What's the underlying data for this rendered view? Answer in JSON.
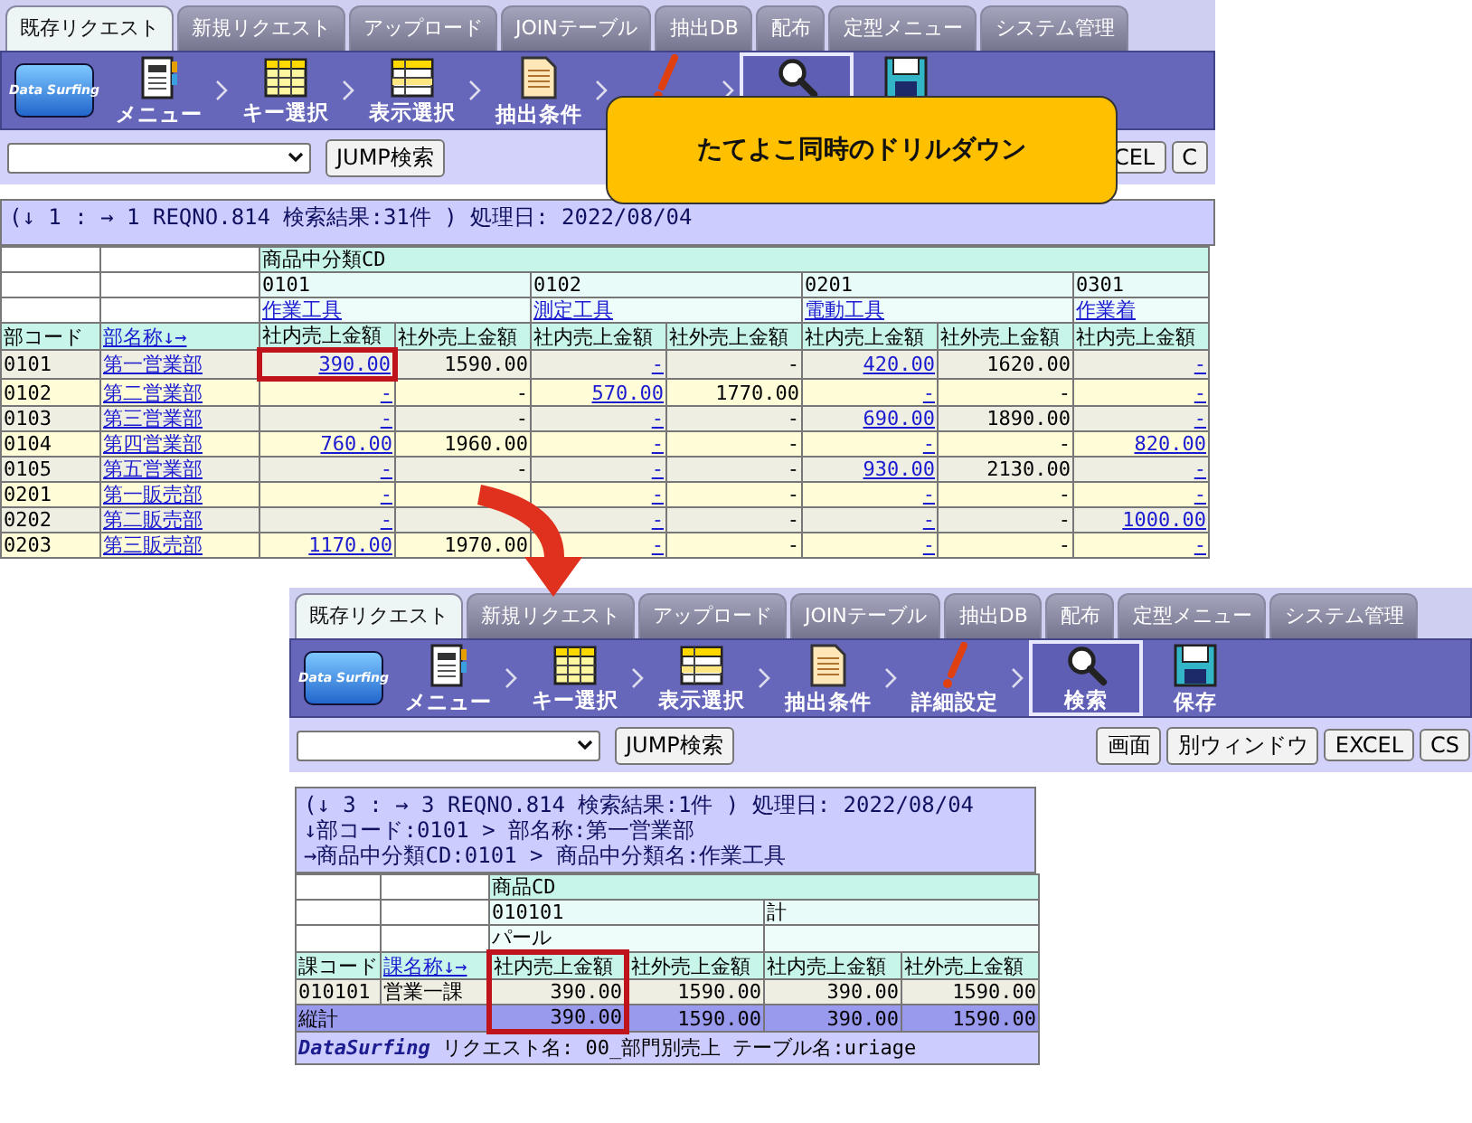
{
  "windows": [
    {
      "tabs": [
        {
          "label": "既存リクエスト",
          "selected": true
        },
        {
          "label": "新規リクエスト",
          "selected": false
        },
        {
          "label": "アップロード",
          "selected": false
        },
        {
          "label": "JOINテーブル",
          "selected": false
        },
        {
          "label": "抽出DB",
          "selected": false
        },
        {
          "label": "配布",
          "selected": false
        },
        {
          "label": "定型メニュー",
          "selected": false
        },
        {
          "label": "システム管理",
          "selected": false
        }
      ],
      "toolbar": {
        "logo_text": "Data Surfing",
        "items": [
          {
            "kind": "menu",
            "label": "メニュー",
            "selected": false
          },
          {
            "kind": "key",
            "label": "キー選択",
            "selected": false
          },
          {
            "kind": "display",
            "label": "表示選択",
            "selected": false
          },
          {
            "kind": "filter",
            "label": "抽出条件",
            "selected": false
          },
          {
            "kind": "detail",
            "selected": false
          },
          {
            "kind": "search",
            "selected": true
          },
          {
            "kind": "save",
            "selected": false
          }
        ]
      },
      "nav": {
        "jump_button": "JUMP検索",
        "buttons": [
          "CEL",
          "C"
        ]
      },
      "info": [
        "(↓ 1 : → 1 REQNO.814 検索結果:31件 ) 処理日: 2022/08/04"
      ],
      "table": {
        "dimension": "商品中分類CD",
        "groups": [
          {
            "code": "0101",
            "name": "作業工具",
            "link": true
          },
          {
            "code": "0102",
            "name": "測定工具",
            "link": true
          },
          {
            "code": "0201",
            "name": "電動工具",
            "link": true
          },
          {
            "code": "0301",
            "name": "作業着",
            "link": true
          }
        ],
        "columns": [
          {
            "header": "部コード",
            "header_link": false,
            "link": false,
            "highlighted": false
          },
          {
            "header": "部名称↓→",
            "header_link": true,
            "link": true,
            "highlighted": false
          },
          {
            "header": "社内売上金額",
            "header_link": false,
            "link": true,
            "highlighted": false
          },
          {
            "header": "社外売上金額",
            "header_link": false,
            "link": false,
            "highlighted": false
          },
          {
            "header": "社内売上金額",
            "header_link": false,
            "link": true,
            "highlighted": false
          },
          {
            "header": "社外売上金額",
            "header_link": false,
            "link": false,
            "highlighted": false
          },
          {
            "header": "社内売上金額",
            "header_link": false,
            "link": true,
            "highlighted": false
          },
          {
            "header": "社外売上金額",
            "header_link": false,
            "link": false,
            "highlighted": false
          },
          {
            "header": "社内売上金額",
            "header_link": false,
            "link": true,
            "highlighted": false
          }
        ],
        "rows": [
          {
            "cells": [
              "0101",
              "第一営業部",
              "390.00",
              "1590.00",
              "-",
              "-",
              "420.00",
              "1620.00",
              "-"
            ],
            "highlighted": true
          },
          {
            "cells": [
              "0102",
              "第二営業部",
              "-",
              "-",
              "570.00",
              "1770.00",
              "-",
              "-",
              "-"
            ],
            "highlighted": false
          },
          {
            "cells": [
              "0103",
              "第三営業部",
              "-",
              "-",
              "-",
              "-",
              "690.00",
              "1890.00",
              "-"
            ],
            "highlighted": false
          },
          {
            "cells": [
              "0104",
              "第四営業部",
              "760.00",
              "1960.00",
              "-",
              "-",
              "-",
              "-",
              "820.00"
            ],
            "highlighted": false
          },
          {
            "cells": [
              "0105",
              "第五営業部",
              "-",
              "-",
              "-",
              "-",
              "930.00",
              "2130.00",
              "-"
            ],
            "highlighted": false
          },
          {
            "cells": [
              "0201",
              "第一販売部",
              "-",
              null,
              "-",
              "-",
              "-",
              "-",
              "-"
            ],
            "highlighted": false
          },
          {
            "cells": [
              "0202",
              "第二販売部",
              "-",
              null,
              "-",
              "-",
              "-",
              "-",
              "1000.00"
            ],
            "highlighted": false
          },
          {
            "cells": [
              "0203",
              "第三販売部",
              "1170.00",
              "1970.00",
              "-",
              "-",
              "-",
              "-",
              "-"
            ],
            "highlighted": false
          }
        ]
      }
    },
    {
      "tabs": [
        {
          "label": "既存リクエスト",
          "selected": true
        },
        {
          "label": "新規リクエスト",
          "selected": false
        },
        {
          "label": "アップロード",
          "selected": false
        },
        {
          "label": "JOINテーブル",
          "selected": false
        },
        {
          "label": "抽出DB",
          "selected": false
        },
        {
          "label": "配布",
          "selected": false
        },
        {
          "label": "定型メニュー",
          "selected": false
        },
        {
          "label": "システム管理",
          "selected": false
        }
      ],
      "toolbar": {
        "logo_text": "Data Surfing",
        "items": [
          {
            "kind": "menu",
            "label": "メニュー",
            "selected": false
          },
          {
            "kind": "key",
            "label": "キー選択",
            "selected": false
          },
          {
            "kind": "display",
            "label": "表示選択",
            "selected": false
          },
          {
            "kind": "filter",
            "label": "抽出条件",
            "selected": false
          },
          {
            "kind": "detail",
            "label": "詳細設定",
            "selected": false
          },
          {
            "kind": "search",
            "label": "検索",
            "selected": true
          },
          {
            "kind": "save",
            "label": "保存",
            "selected": false
          }
        ]
      },
      "nav": {
        "jump_button": "JUMP検索",
        "buttons": [
          "画面",
          "別ウィンドウ",
          "EXCEL",
          "CS"
        ]
      },
      "info": [
        "(↓ 3 : → 3 REQNO.814 検索結果:1件 ) 処理日: 2022/08/04",
        "↓部コード:0101 > 部名称:第一営業部",
        "→商品中分類CD:0101 > 商品中分類名:作業工具"
      ],
      "table": {
        "dimension": "商品CD",
        "groups": [
          {
            "code": "010101",
            "name": "パール",
            "link": false
          },
          {
            "code": "計"
          }
        ],
        "columns": [
          {
            "header": "課コード",
            "header_link": false,
            "link": false,
            "highlighted": false
          },
          {
            "header": "課名称↓→",
            "header_link": true,
            "link": false,
            "highlighted": false
          },
          {
            "header": "社内売上金額",
            "header_link": false,
            "link": false,
            "highlighted": true
          },
          {
            "header": "社外売上金額",
            "header_link": false,
            "link": false,
            "highlighted": false
          },
          {
            "header": "社内売上金額",
            "header_link": false,
            "link": false,
            "highlighted": false
          },
          {
            "header": "社外売上金額",
            "header_link": false,
            "link": false,
            "highlighted": false
          }
        ],
        "rows": [
          {
            "cells": [
              "010101",
              "営業一課",
              "390.00",
              "1590.00",
              "390.00",
              "1590.00"
            ],
            "highlighted": false
          }
        ],
        "total": {
          "label": "縦計",
          "cells": [
            "390.00",
            "1590.00",
            "390.00",
            "1590.00"
          ]
        },
        "footer": {
          "brand": "DataSurfing",
          "text": "リクエスト名: 00_部門別売上 テーブル名:uriage"
        }
      }
    }
  ],
  "callout": {
    "text": "たてよこ同時のドリルダウン"
  }
}
